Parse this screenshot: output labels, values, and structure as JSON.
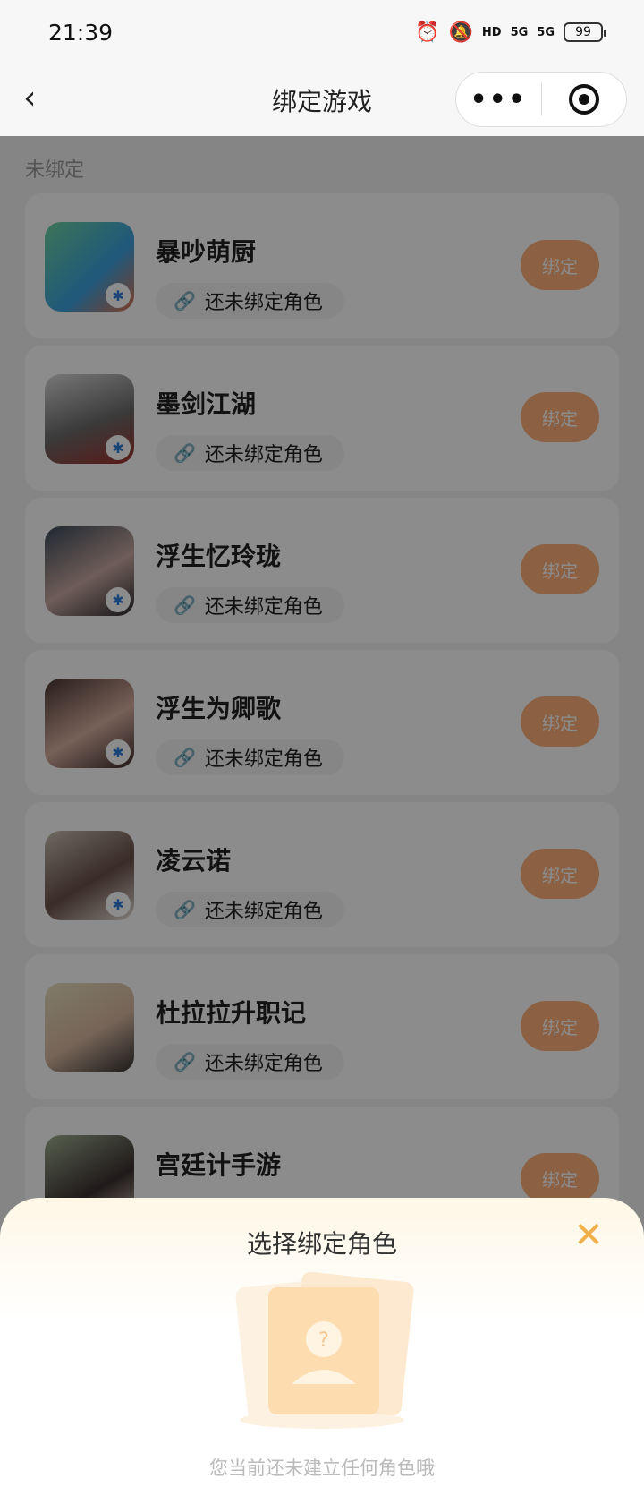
{
  "status_bar": {
    "time": "21:39",
    "network_1": "5G",
    "network_2": "5G",
    "hd_label": "HD",
    "battery": "99"
  },
  "nav": {
    "title": "绑定游戏",
    "more_label": "•••"
  },
  "section": {
    "label": "未绑定"
  },
  "games": [
    {
      "name": "暴吵萌厨",
      "role_status": "还未绑定角色",
      "bind_label": "绑定"
    },
    {
      "name": "墨剑江湖",
      "role_status": "还未绑定角色",
      "bind_label": "绑定"
    },
    {
      "name": "浮生忆玲珑",
      "role_status": "还未绑定角色",
      "bind_label": "绑定"
    },
    {
      "name": "浮生为卿歌",
      "role_status": "还未绑定角色",
      "bind_label": "绑定"
    },
    {
      "name": "凌云诺",
      "role_status": "还未绑定角色",
      "bind_label": "绑定"
    },
    {
      "name": "杜拉拉升职记",
      "role_status": "还未绑定角色",
      "bind_label": "绑定"
    },
    {
      "name": "宫廷计手游",
      "role_status": "",
      "bind_label": "绑定"
    }
  ],
  "sheet": {
    "title": "选择绑定角色",
    "empty_text": "您当前还未建立任何角色哦"
  },
  "colors": {
    "bind_button": "#ffb07a",
    "close_icon": "#f0b14d"
  }
}
